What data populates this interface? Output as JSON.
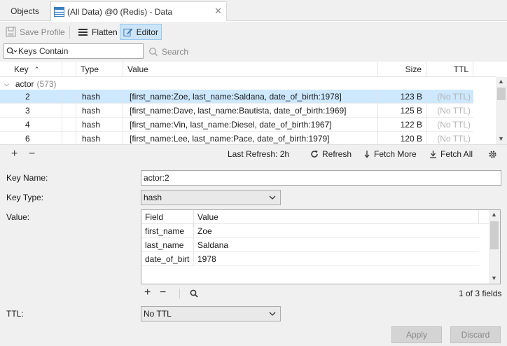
{
  "tabs": [
    {
      "label": "Objects"
    },
    {
      "label": "(All Data) @0 (Redis) - Data"
    }
  ],
  "toolbar": {
    "save_profile": "Save Profile",
    "flatten": "Flatten",
    "editor": "Editor"
  },
  "search": {
    "placeholder": "Keys Contain",
    "button": "Search"
  },
  "grid": {
    "columns": {
      "key": "Key",
      "type": "Type",
      "value": "Value",
      "size": "Size",
      "ttl": "TTL"
    },
    "group": {
      "name": "actor",
      "count": "(573)"
    },
    "rows": [
      {
        "key": "2",
        "type": "hash",
        "value": "[first_name:Zoe, last_name:Saldana, date_of_birth:1978]",
        "size": "123 B",
        "ttl": "(No TTL)"
      },
      {
        "key": "3",
        "type": "hash",
        "value": "[first_name:Dave, last_name:Bautista, date_of_birth:1969]",
        "size": "125 B",
        "ttl": "(No TTL)"
      },
      {
        "key": "4",
        "type": "hash",
        "value": "[first_name:Vin, last_name:Diesel, date_of_birth:1967]",
        "size": "122 B",
        "ttl": "(No TTL)"
      },
      {
        "key": "6",
        "type": "hash",
        "value": "[first_name:Lee, last_name:Pace, date_of_birth:1979]",
        "size": "120 B",
        "ttl": "(No TTL)"
      }
    ]
  },
  "gridbar": {
    "last_refresh": "Last Refresh: 2h",
    "refresh": "Refresh",
    "fetch_more": "Fetch More",
    "fetch_all": "Fetch All"
  },
  "editor": {
    "key_name_label": "Key Name:",
    "key_name_value": "actor:2",
    "key_type_label": "Key Type:",
    "key_type_value": "hash",
    "value_label": "Value:",
    "value_columns": {
      "field": "Field",
      "value": "Value"
    },
    "value_rows": [
      {
        "field": "first_name",
        "value": "Zoe"
      },
      {
        "field": "last_name",
        "value": "Saldana"
      },
      {
        "field": "date_of_birt",
        "value": "1978"
      }
    ],
    "fields_count": "1 of 3 fields",
    "ttl_label": "TTL:",
    "ttl_value": "No TTL",
    "apply": "Apply",
    "discard": "Discard"
  },
  "colors": {
    "selection": "#cde8ff",
    "active_button": "#cce4f7",
    "panel": "#f0f0f0"
  }
}
